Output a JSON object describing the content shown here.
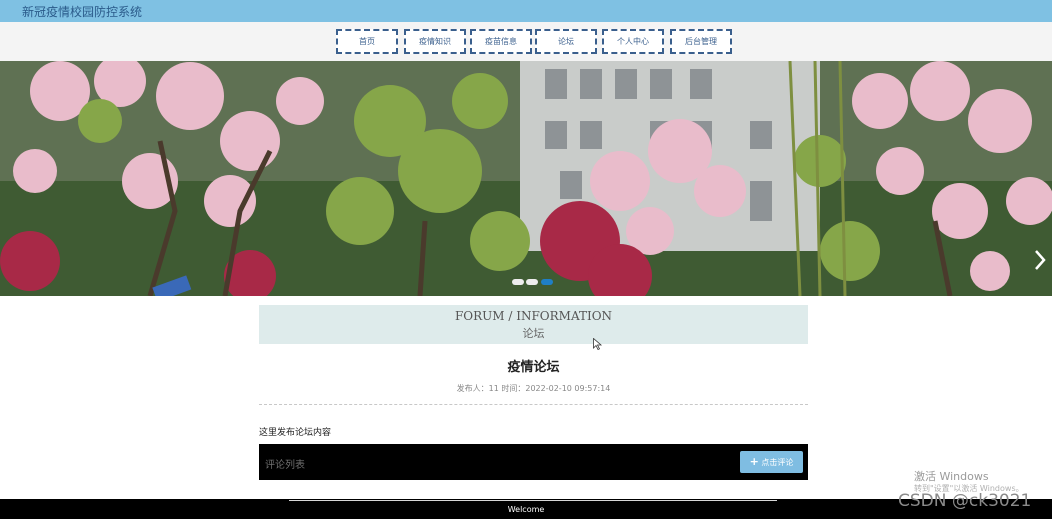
{
  "app": {
    "title": "新冠疫情校园防控系统"
  },
  "nav": {
    "items": [
      {
        "label": "首页"
      },
      {
        "label": "疫情知识"
      },
      {
        "label": "疫苗信息"
      },
      {
        "label": "论坛"
      },
      {
        "label": "个人中心"
      },
      {
        "label": "后台管理"
      }
    ]
  },
  "banner": {
    "active_slide": 3,
    "slide_count": 3,
    "next_icon": "chevron-right-icon"
  },
  "section": {
    "title_en": "FORUM / INFORMATION",
    "title_cn": "论坛"
  },
  "post": {
    "title": "疫情论坛",
    "meta": "发布人：11 时间：2022-02-10 09:57:14",
    "content": "这里发布论坛内容"
  },
  "comments": {
    "label": "评论列表",
    "button_label": "点击评论",
    "button_icon": "plus-icon"
  },
  "footer": {
    "text": "Welcome"
  },
  "watermark": {
    "activate": "激活 Windows",
    "settings_hint": "转到\"设置\"以激活 Windows。",
    "csdn": "CSDN @ck3021"
  },
  "colors": {
    "topbar": "#7fc1e3",
    "nav_border": "#3a5f8d",
    "accent_button": "#7fbde2",
    "section_head": "#deebeb"
  }
}
